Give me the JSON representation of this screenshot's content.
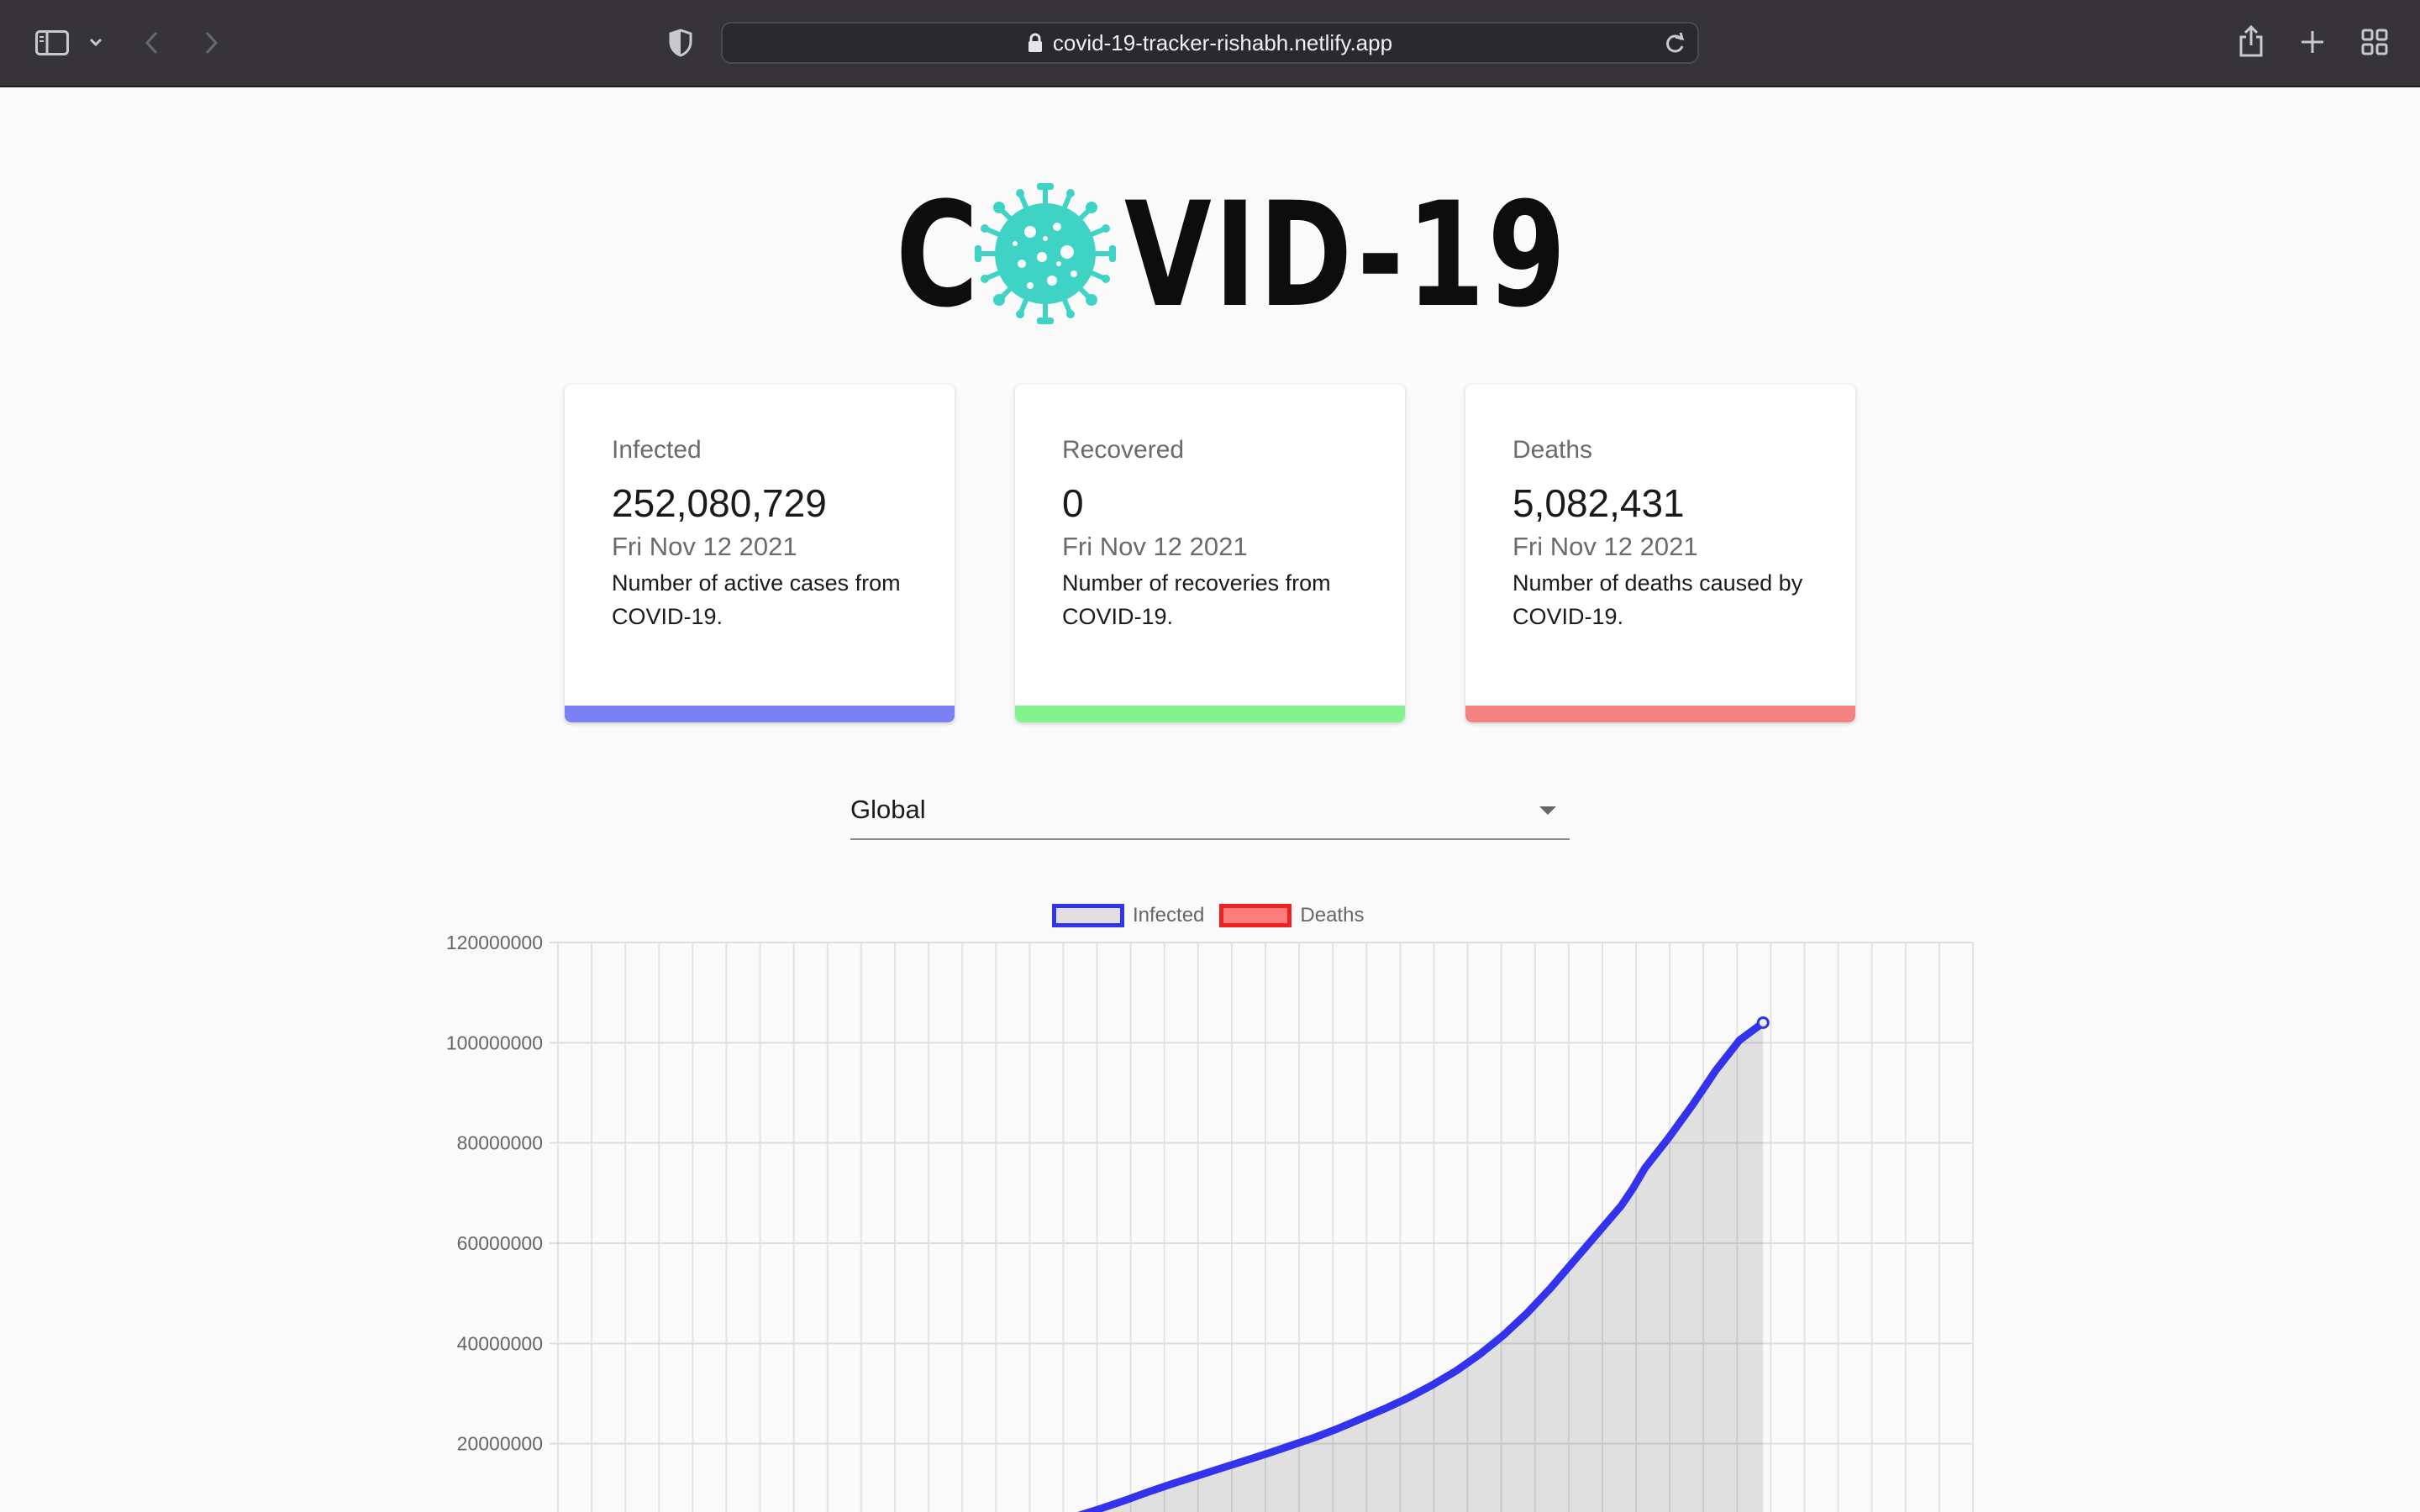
{
  "browser": {
    "url": "covid-19-tracker-rishabh.netlify.app"
  },
  "logo": {
    "text_prefix": "C",
    "text_suffix": "VID-19",
    "accent_color": "#3fd3c6"
  },
  "cards": [
    {
      "label": "Infected",
      "value": "252,080,729",
      "date": "Fri Nov 12 2021",
      "description": "Number of active cases from COVID-19.",
      "color": "#7b80f2"
    },
    {
      "label": "Recovered",
      "value": "0",
      "date": "Fri Nov 12 2021",
      "description": "Number of recoveries from COVID-19.",
      "color": "#83f28f"
    },
    {
      "label": "Deaths",
      "value": "5,082,431",
      "date": "Fri Nov 12 2021",
      "description": "Number of deaths caused by COVID-19.",
      "color": "#f58282"
    }
  ],
  "country_select": {
    "selected": "Global"
  },
  "chart_data": {
    "type": "line",
    "legend": [
      "Infected",
      "Deaths"
    ],
    "legend_placement": "top",
    "ylim": [
      0,
      120000000
    ],
    "yticks": [
      "120000000",
      "100000000",
      "80000000",
      "60000000",
      "40000000",
      "20000000"
    ],
    "grid": true,
    "series": [
      {
        "name": "Infected",
        "color": "#3333ee",
        "fill": "rgba(0,0,0,0.1)",
        "points": [
          [
            0.0,
            0
          ],
          [
            0.34,
            0
          ],
          [
            0.36,
            600000
          ],
          [
            0.38,
            1700000
          ],
          [
            0.4,
            2900000
          ],
          [
            0.42,
            4200000
          ],
          [
            0.44,
            5600000
          ],
          [
            0.46,
            7100000
          ],
          [
            0.48,
            8700000
          ],
          [
            0.5,
            10400000
          ],
          [
            0.52,
            12000000
          ],
          [
            0.54,
            13500000
          ],
          [
            0.56,
            15000000
          ],
          [
            0.58,
            16500000
          ],
          [
            0.6,
            18000000
          ],
          [
            0.62,
            19600000
          ],
          [
            0.64,
            21200000
          ],
          [
            0.66,
            23000000
          ],
          [
            0.68,
            25000000
          ],
          [
            0.7,
            27000000
          ],
          [
            0.72,
            29200000
          ],
          [
            0.74,
            31700000
          ],
          [
            0.76,
            34500000
          ],
          [
            0.78,
            37800000
          ],
          [
            0.8,
            41600000
          ],
          [
            0.82,
            46000000
          ],
          [
            0.84,
            51000000
          ],
          [
            0.86,
            56500000
          ],
          [
            0.88,
            62000000
          ],
          [
            0.9,
            67500000
          ],
          [
            0.91,
            71000000
          ],
          [
            0.92,
            75000000
          ],
          [
            0.94,
            81000000
          ],
          [
            0.96,
            87500000
          ],
          [
            0.98,
            94500000
          ],
          [
            1.0,
            100500000
          ],
          [
            1.02,
            104000000
          ]
        ]
      },
      {
        "name": "Deaths",
        "color": "#ee2222",
        "fill": "rgba(255,0,0,0.5)",
        "points": []
      }
    ]
  }
}
